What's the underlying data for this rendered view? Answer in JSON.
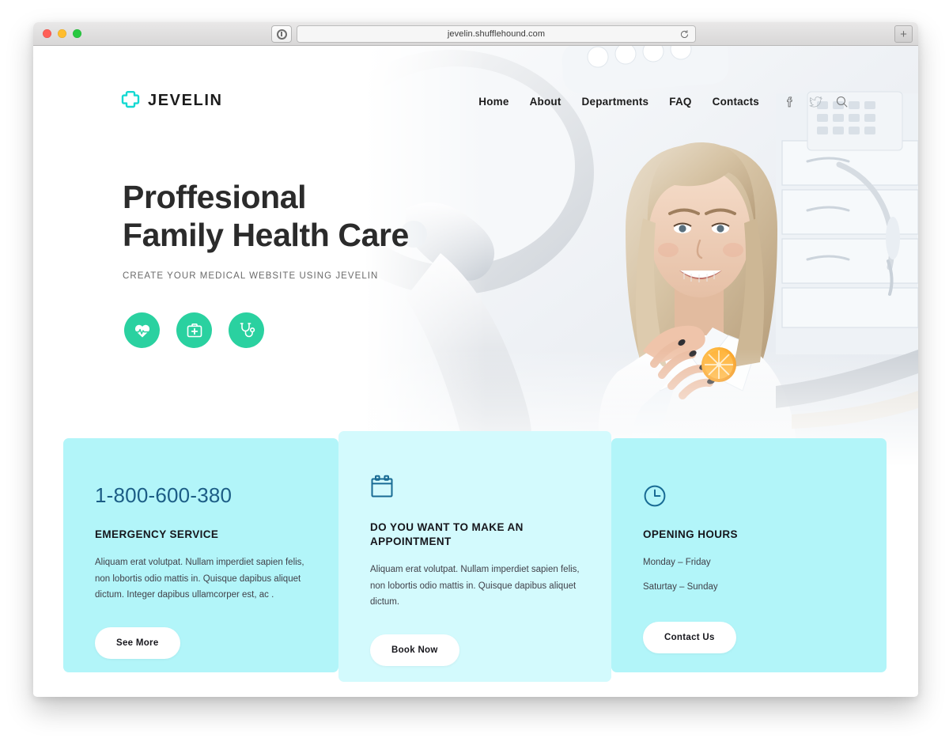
{
  "browser": {
    "url": "jevelin.shufflehound.com",
    "shield_icon": "shield-icon",
    "reload_icon": "reload-icon",
    "new_tab_label": "+",
    "traffic_lights": [
      "close-button",
      "minimize-button",
      "maximize-button"
    ]
  },
  "site": {
    "brand": {
      "name": "JEVELIN",
      "mark_icon": "medical-cross-logo-icon",
      "mark_color": "#14d9d2"
    },
    "nav": {
      "links": [
        {
          "label": "Home"
        },
        {
          "label": "About"
        },
        {
          "label": "Departments"
        },
        {
          "label": "FAQ"
        },
        {
          "label": "Contacts"
        }
      ],
      "icons": [
        {
          "name": "facebook-icon"
        },
        {
          "name": "twitter-icon"
        },
        {
          "name": "search-icon"
        }
      ]
    },
    "hero": {
      "title": "Proffesional\nFamily Health Care",
      "subtitle": "CREATE YOUR MEDICAL WEBSITE USING JEVELIN",
      "badges": [
        {
          "icon": "heartbeat-icon"
        },
        {
          "icon": "medical-kit-icon"
        },
        {
          "icon": "stethoscope-icon"
        }
      ],
      "badge_color": "#2ad1a0"
    },
    "cards": {
      "emergency": {
        "phone": "1-800-600-380",
        "title": "EMERGENCY SERVICE",
        "body": "Aliquam erat volutpat. Nullam imperdiet sapien felis, non lobortis odio mattis in. Quisque dapibus aliquet dictum. Integer dapibus ullamcorper est, ac .",
        "button": "See More",
        "bg_color": "#b2f5f9",
        "phone_color": "#1c5d86"
      },
      "appointment": {
        "icon": "calendar-icon",
        "title": "DO YOU WANT TO MAKE AN APPOINTMENT",
        "body": "Aliquam erat volutpat. Nullam imperdiet sapien felis, non lobortis odio mattis in. Quisque dapibus aliquet dictum.",
        "button": "Book Now",
        "bg_color": "#d3fafd"
      },
      "hours": {
        "icon": "clock-icon",
        "title": "OPENING HOURS",
        "line_1": "Monday – Friday",
        "line_2": "Saturtay – Sunday",
        "button": "Contact Us",
        "bg_color": "#b2f5f9"
      }
    }
  }
}
